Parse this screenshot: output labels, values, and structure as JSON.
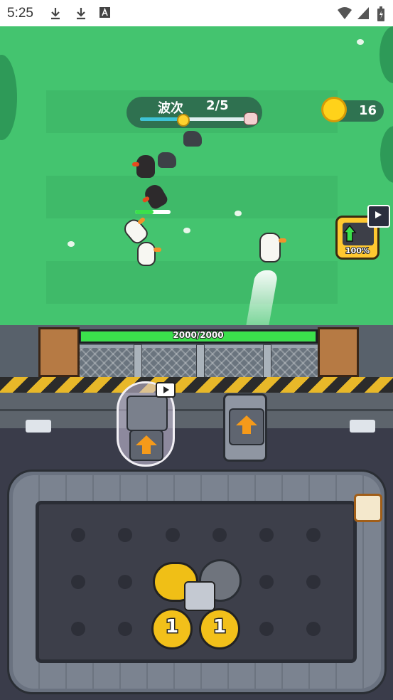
{
  "status_bar": {
    "time": "5:25",
    "icons": [
      "download-icon",
      "download-icon",
      "text-icon",
      "wifi-icon",
      "signal-icon",
      "battery-icon"
    ]
  },
  "hud": {
    "wave_label": "波次",
    "wave_count": "2/5",
    "wave_progress": 0.4,
    "coins": "16"
  },
  "auto_button": {
    "percent": "100%"
  },
  "wall": {
    "hp_text": "2000/2000",
    "hp_fraction": 1.0
  },
  "board": {
    "gears": [
      "1",
      "1"
    ]
  },
  "colors": {
    "grass": "#44c46f",
    "hp_green": "#3be04c",
    "gold": "#f2c01a",
    "upgrade_orange": "#f59a1a"
  }
}
